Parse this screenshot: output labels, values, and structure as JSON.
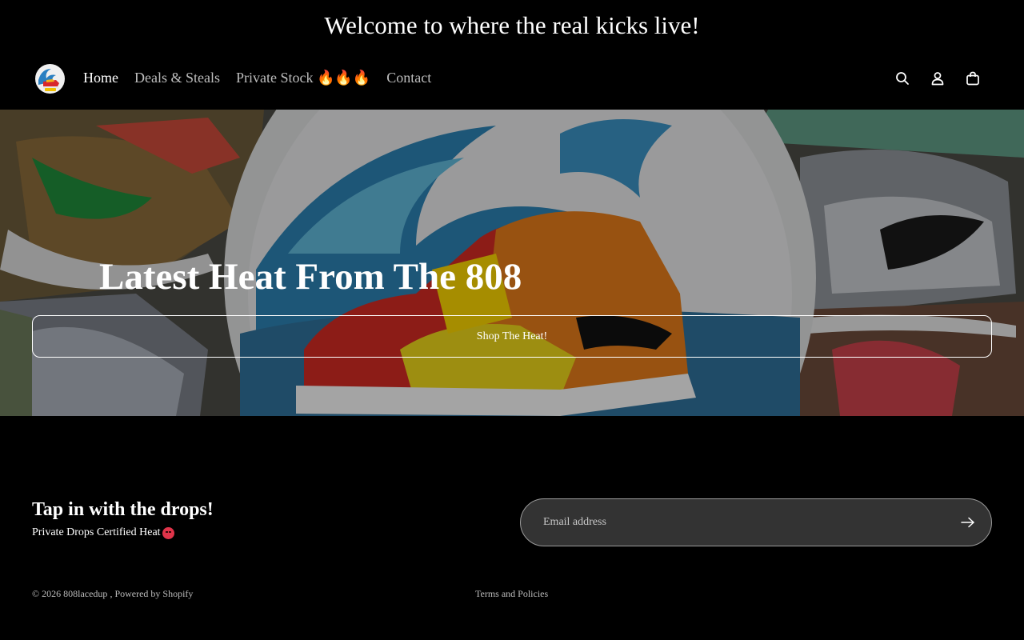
{
  "announcement": {
    "text": "Welcome to where the real kicks live!"
  },
  "header": {
    "logo_icon": "808-wave-sneaker-logo",
    "nav": [
      {
        "label": "Home",
        "active": true
      },
      {
        "label": "Deals & Steals",
        "active": false
      },
      {
        "label": "Private Stock 🔥🔥🔥",
        "active": false
      },
      {
        "label": "Contact",
        "active": false
      }
    ],
    "icons": [
      "search-icon",
      "account-icon",
      "cart-icon"
    ]
  },
  "hero": {
    "title": "Latest Heat From The 808",
    "button_label": "Shop The Heat!"
  },
  "newsletter": {
    "title": "Tap in with the drops!",
    "subtitle": "Private Drops Certified Heat",
    "subtitle_emoji": "angry-face-emoji",
    "email_placeholder": "Email address",
    "submit_icon": "arrow-right-icon"
  },
  "footer": {
    "copyright_prefix": "© 2026 808lacedup",
    "powered_by": ", Powered by Shopify",
    "terms": "Terms and Policies"
  },
  "colors": {
    "background": "#000000",
    "text": "#ffffff",
    "muted_text": "#bdbdbd",
    "input_bg": "#333333"
  }
}
